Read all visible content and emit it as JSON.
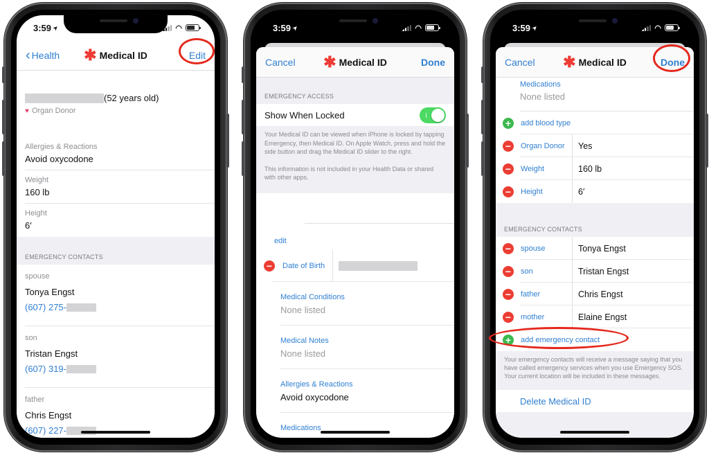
{
  "status_bar": {
    "time": "3:59",
    "location_glyph": "➤"
  },
  "screens": [
    {
      "nav": {
        "back_label": "Health",
        "title": "Medical ID",
        "right_label": "Edit"
      },
      "profile": {
        "age": "(52 years old)",
        "organ_donor": "Organ Donor"
      },
      "fields": [
        {
          "label": "Allergies & Reactions",
          "value": "Avoid oxycodone"
        },
        {
          "label": "Weight",
          "value": "160 lb"
        },
        {
          "label": "Height",
          "value": "6′"
        }
      ],
      "contacts_header": "EMERGENCY CONTACTS",
      "contacts": [
        {
          "relation": "spouse",
          "name": "Tonya Engst",
          "phone": "(607) 275-"
        },
        {
          "relation": "son",
          "name": "Tristan Engst",
          "phone": "(607) 319-"
        },
        {
          "relation": "father",
          "name": "Chris Engst",
          "phone": "(607) 227-"
        }
      ]
    },
    {
      "nav": {
        "left_label": "Cancel",
        "title": "Medical ID",
        "right_label": "Done"
      },
      "emergency_access": {
        "header": "EMERGENCY ACCESS",
        "toggle_label": "Show When Locked",
        "toggle_on": true,
        "footer_1": "Your Medical ID can be viewed when iPhone is locked by tapping Emergency, then Medical ID. On Apple Watch, press and hold the side button and drag the Medical ID slider to the right.",
        "footer_2": "This information is not included in your Health Data or shared with other apps."
      },
      "photo_edit_label": "edit",
      "dob_label": "Date of Birth",
      "fields": [
        {
          "label": "Medical Conditions",
          "value": "None listed",
          "placeholder": true
        },
        {
          "label": "Medical Notes",
          "value": "None listed",
          "placeholder": true
        },
        {
          "label": "Allergies & Reactions",
          "value": "Avoid oxycodone",
          "placeholder": false
        },
        {
          "label": "Medications",
          "value": "",
          "placeholder": false
        }
      ]
    },
    {
      "nav": {
        "left_label": "Cancel",
        "title": "Medical ID",
        "right_label": "Done"
      },
      "medications": {
        "label": "Medications",
        "value": "None listed"
      },
      "add_blood_type": "add blood type",
      "edit_fields": [
        {
          "key": "Organ Donor",
          "value": "Yes"
        },
        {
          "key": "Weight",
          "value": "160 lb"
        },
        {
          "key": "Height",
          "value": "6′"
        }
      ],
      "contacts_header": "EMERGENCY CONTACTS",
      "contacts": [
        {
          "relation": "spouse",
          "name": "Tonya Engst"
        },
        {
          "relation": "son",
          "name": "Tristan Engst"
        },
        {
          "relation": "father",
          "name": "Chris Engst"
        },
        {
          "relation": "mother",
          "name": "Elaine Engst"
        }
      ],
      "add_contact": "add emergency contact",
      "contacts_footer": "Your emergency contacts will receive a message saying that you have called emergency services when you use Emergency SOS. Your current location will be included in these messages.",
      "delete_label": "Delete Medical ID"
    }
  ],
  "colors": {
    "accent": "#2f7fd1",
    "destructive": "#ec3d33",
    "add": "#3cb94e",
    "toggle_on": "#4cd964",
    "annotation": "#e5281d"
  }
}
